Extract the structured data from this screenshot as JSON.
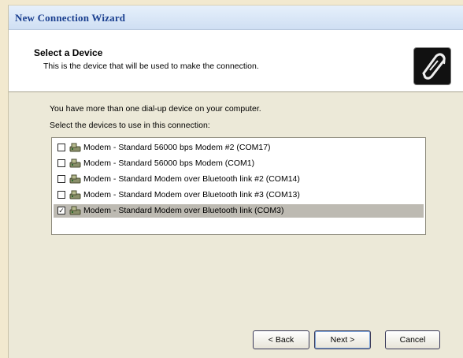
{
  "window": {
    "title": "New Connection Wizard"
  },
  "header": {
    "title": "Select a Device",
    "subtitle": "This is the device that will be used to make the connection."
  },
  "body": {
    "intro": "You have more than one dial-up device on your computer.",
    "select_label": "Select the devices to use in this connection:"
  },
  "devices": [
    {
      "label": "Modem - Standard 56000 bps Modem #2 (COM17)",
      "checked": false
    },
    {
      "label": "Modem - Standard 56000 bps Modem (COM1)",
      "checked": false
    },
    {
      "label": "Modem - Standard Modem over Bluetooth link #2 (COM14)",
      "checked": false
    },
    {
      "label": "Modem - Standard Modem over Bluetooth link #3 (COM13)",
      "checked": false
    },
    {
      "label": "Modem - Standard Modem over Bluetooth link (COM3)",
      "checked": true
    }
  ],
  "buttons": {
    "back": "< Back",
    "next": "Next >",
    "cancel": "Cancel"
  },
  "icons": {
    "header": "phone-icon",
    "device": "modem-icon"
  }
}
